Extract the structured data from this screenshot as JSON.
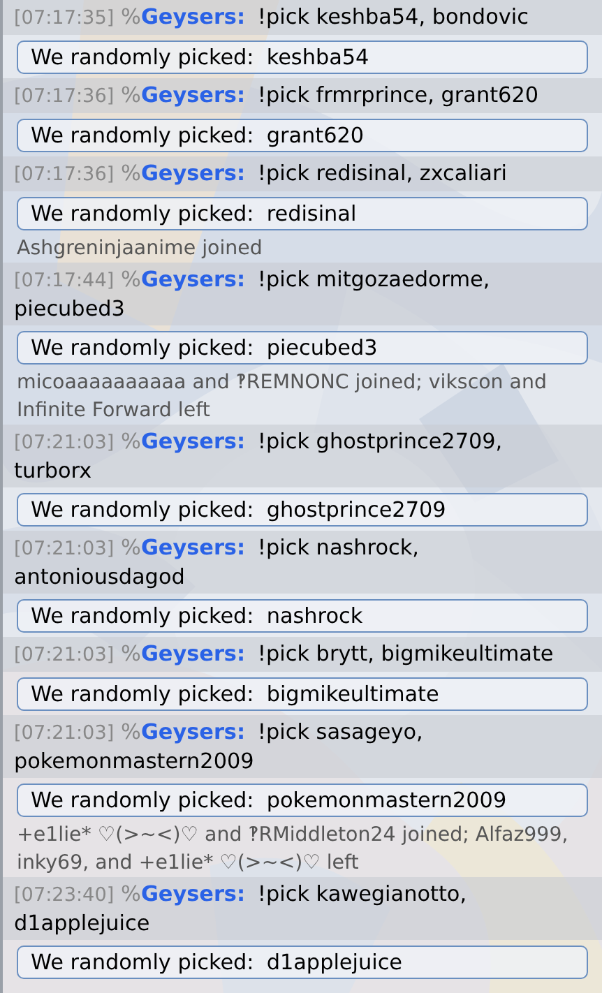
{
  "messages": [
    {
      "kind": "chat",
      "time": "[07:17:35]",
      "rank": "%",
      "user": "Geysers:",
      "text": "!pick keshba54, bondovic"
    },
    {
      "kind": "result",
      "label": "We randomly picked:",
      "value": "keshba54"
    },
    {
      "kind": "chat",
      "time": "[07:17:36]",
      "rank": "%",
      "user": "Geysers:",
      "text": "!pick frmrprince, grant620"
    },
    {
      "kind": "result",
      "label": "We randomly picked:",
      "value": "grant620"
    },
    {
      "kind": "chat",
      "time": "[07:17:36]",
      "rank": "%",
      "user": "Geysers:",
      "text": "!pick redisinal, zxcaliari"
    },
    {
      "kind": "result",
      "label": "We randomly picked:",
      "value": "redisinal"
    },
    {
      "kind": "notice",
      "text": "Ashgreninjaanime joined"
    },
    {
      "kind": "chat",
      "time": "[07:17:44]",
      "rank": "%",
      "user": "Geysers:",
      "text": "!pick mitgozaedorme, piecubed3"
    },
    {
      "kind": "result",
      "label": "We randomly picked:",
      "value": "piecubed3"
    },
    {
      "kind": "notice",
      "text": "micoaaaaaaaaaa and ‽REMNONC joined; vikscon and Infinite Forward left"
    },
    {
      "kind": "chat",
      "time": "[07:21:03]",
      "rank": "%",
      "user": "Geysers:",
      "text": "!pick ghostprince2709, turborx"
    },
    {
      "kind": "result",
      "label": "We randomly picked:",
      "value": "ghostprince2709"
    },
    {
      "kind": "chat",
      "time": "[07:21:03]",
      "rank": "%",
      "user": "Geysers:",
      "text": "!pick nashrock, antoniousdagod"
    },
    {
      "kind": "result",
      "label": "We randomly picked:",
      "value": "nashrock"
    },
    {
      "kind": "chat",
      "time": "[07:21:03]",
      "rank": "%",
      "user": "Geysers:",
      "text": "!pick brytt, bigmikeultimate"
    },
    {
      "kind": "result",
      "label": "We randomly picked:",
      "value": "bigmikeultimate"
    },
    {
      "kind": "chat",
      "time": "[07:21:03]",
      "rank": "%",
      "user": "Geysers:",
      "text": "!pick sasageyo, pokemonmastern2009"
    },
    {
      "kind": "result",
      "label": "We randomly picked:",
      "value": "pokemonmastern2009"
    },
    {
      "kind": "notice",
      "text": "+e1lie* ♡(>~<)♡ and ‽RMiddleton24 joined; Alfaz999, inky69, and +e1lie* ♡(>~<)♡ left"
    },
    {
      "kind": "chat",
      "time": "[07:23:40]",
      "rank": "%",
      "user": "Geysers:",
      "text": "!pick kawegianotto, d1applejuice"
    },
    {
      "kind": "result",
      "label": "We randomly picked:",
      "value": "d1applejuice"
    }
  ]
}
